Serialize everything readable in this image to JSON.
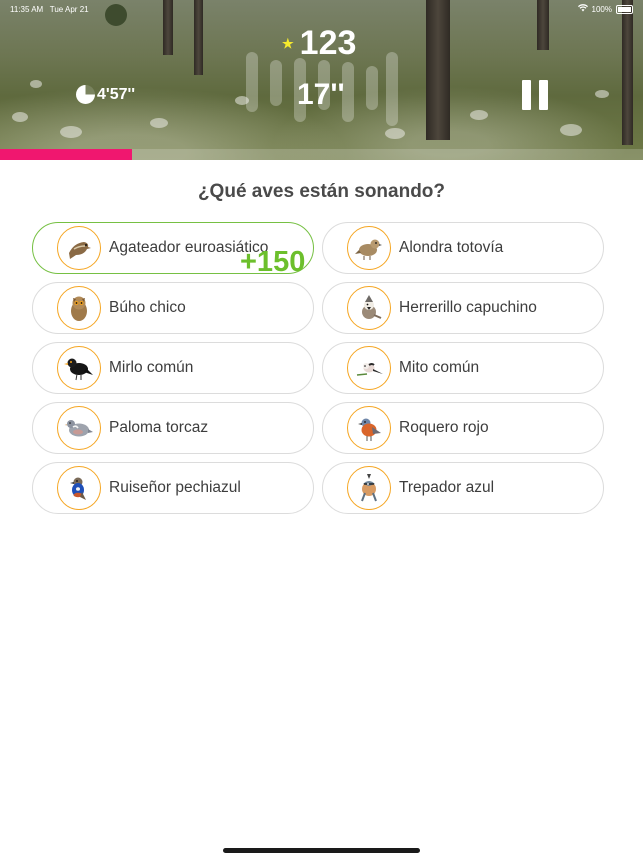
{
  "status_bar": {
    "time": "11:35 AM",
    "date": "Tue Apr 21",
    "battery": "100%"
  },
  "game": {
    "score": "123",
    "round_timer": "17''",
    "total_timer": "4'57''",
    "progress": 0.205,
    "progress_color": "#f0176f"
  },
  "question": "¿Qué aves están sonando?",
  "answers": [
    {
      "label": "Agateador euroasiático",
      "icon": "treecreeper-icon",
      "correct": true
    },
    {
      "label": "Alondra totovía",
      "icon": "woodlark-icon"
    },
    {
      "label": "Búho chico",
      "icon": "owl-icon"
    },
    {
      "label": "Herrerillo capuchino",
      "icon": "crested-tit-icon"
    },
    {
      "label": "Mirlo común",
      "icon": "blackbird-icon"
    },
    {
      "label": "Mito común",
      "icon": "long-tailed-tit-icon"
    },
    {
      "label": "Paloma torcaz",
      "icon": "pigeon-icon"
    },
    {
      "label": "Roquero rojo",
      "icon": "rock-thrush-icon"
    },
    {
      "label": "Ruiseñor pechiazul",
      "icon": "bluethroat-icon"
    },
    {
      "label": "Trepador azul",
      "icon": "nuthatch-icon"
    }
  ],
  "points_feedback": "+150",
  "colors": {
    "correct": "#76c043",
    "avatar_ring": "#f5a623",
    "points": "#6cbf2c"
  }
}
